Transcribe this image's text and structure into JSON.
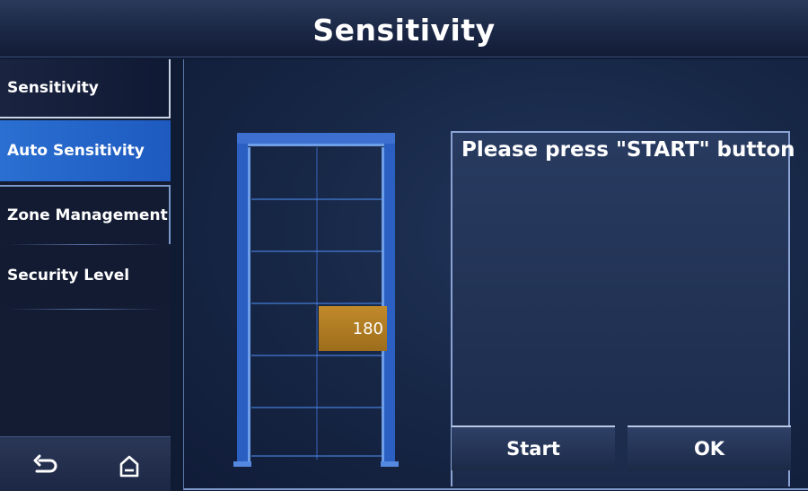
{
  "header": {
    "title": "Sensitivity"
  },
  "sidebar": {
    "items": [
      {
        "label": "Sensitivity"
      },
      {
        "label": "Auto Sensitivity",
        "active": true
      },
      {
        "label": "Zone Management"
      },
      {
        "label": "Security Level"
      }
    ],
    "bottom_icons": [
      "back-icon",
      "home-icon"
    ]
  },
  "main": {
    "sensitivity_value": "180",
    "message": "Please press \"START\" button",
    "buttons": {
      "start_label": "Start",
      "ok_label": "OK"
    }
  },
  "colors": {
    "active_item": "#2a6fd1",
    "value_badge": "#c18a2a",
    "gate": "#2f63c8"
  }
}
